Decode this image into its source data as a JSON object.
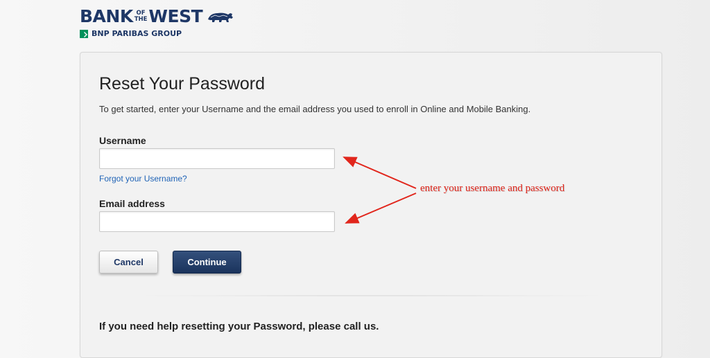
{
  "header": {
    "brand_left": "BANK",
    "brand_of_1": "OF",
    "brand_of_2": "THE",
    "brand_right": "WEST",
    "group": "BNP PARIBAS GROUP"
  },
  "form": {
    "title": "Reset Your Password",
    "intro": "To get started, enter your Username and the email address you used to enroll in Online and Mobile Banking.",
    "username_label": "Username",
    "username_value": "",
    "forgot_link": "Forgot your Username?",
    "email_label": "Email address",
    "email_value": "",
    "cancel_label": "Cancel",
    "continue_label": "Continue",
    "help_text": "If you need help resetting your Password, please call us."
  },
  "annotation": {
    "text": "enter your username and password",
    "color": "#e1261c"
  },
  "colors": {
    "brand_navy": "#1e3766",
    "link_blue": "#1f63b6",
    "bnp_green": "#00915a"
  }
}
